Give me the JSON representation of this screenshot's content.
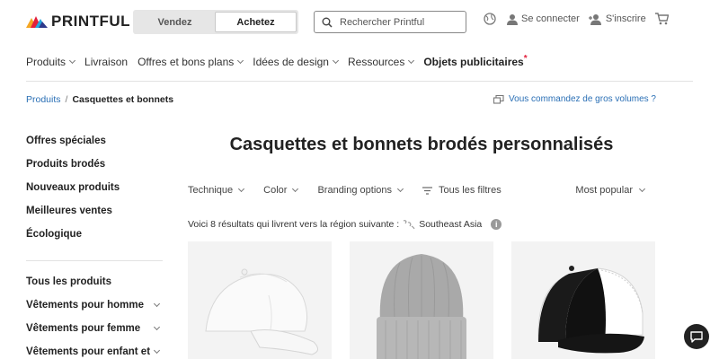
{
  "header": {
    "logo_text": "PRINTFUL",
    "toggle": {
      "sell_label": "Vendez",
      "buy_label": "Achetez",
      "active": "buy"
    },
    "search": {
      "placeholder": "Rechercher Printful",
      "value": ""
    },
    "login_label": "Se connecter",
    "signup_label": "S'inscrire"
  },
  "nav": {
    "items": [
      {
        "label": "Produits",
        "dropdown": true
      },
      {
        "label": "Livraison",
        "dropdown": false
      },
      {
        "label": "Offres et bons plans",
        "dropdown": true
      },
      {
        "label": "Idées de design",
        "dropdown": true
      },
      {
        "label": "Ressources",
        "dropdown": true
      },
      {
        "label": "Objets publicitaires",
        "dropdown": false,
        "bold": true,
        "badge": "*"
      }
    ]
  },
  "breadcrumb": {
    "parent": "Produits",
    "separator": "/",
    "current": "Casquettes et bonnets"
  },
  "bulk_link": "Vous commandez de gros volumes ?",
  "sidebar": {
    "group1": [
      "Offres spéciales",
      "Produits brodés",
      "Nouveaux produits",
      "Meilleures ventes",
      "Écologique"
    ],
    "group2": [
      {
        "label": "Tous les produits",
        "expandable": false
      },
      {
        "label": "Vêtements pour homme",
        "expandable": true
      },
      {
        "label": "Vêtements pour femme",
        "expandable": true
      },
      {
        "label": "Vêtements pour enfant et",
        "expandable": true
      }
    ]
  },
  "main": {
    "title": "Casquettes et bonnets brodés personnalisés",
    "filters": [
      "Technique",
      "Color",
      "Branding options"
    ],
    "all_filters_label": "Tous les filtres",
    "sort_label": "Most popular",
    "results_text": "Voici 8 résultats qui livrent vers la région suivante :",
    "region": "Southeast Asia",
    "info_icon": "i"
  },
  "colors": {
    "link": "#2a6fb5",
    "badge_star": "#e2203c",
    "toggle_bg": "#e6e6e6",
    "card_bg": "#f3f3f3",
    "chat_bg": "#222222"
  }
}
